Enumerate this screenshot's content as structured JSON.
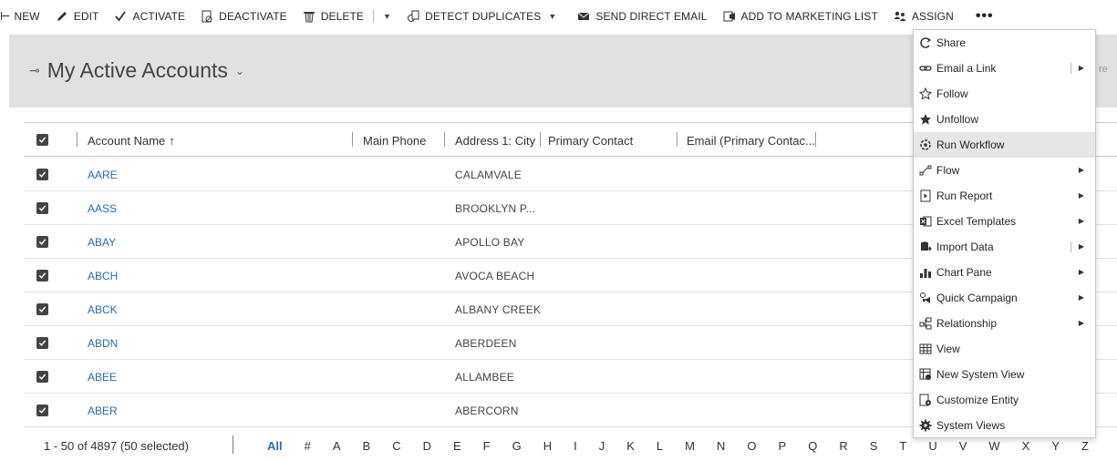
{
  "toolbar": {
    "new": "NEW",
    "edit": "EDIT",
    "activate": "ACTIVATE",
    "deactivate": "DEACTIVATE",
    "delete": "DELETE",
    "detect_duplicates": "DETECT DUPLICATES",
    "send_direct_email": "SEND DIRECT EMAIL",
    "add_to_marketing_list": "ADD TO MARKETING LIST",
    "assign": "ASSIGN",
    "more": "•••"
  },
  "view": {
    "title": "My Active Accounts"
  },
  "columns": {
    "account_name": "Account Name",
    "sort_icon": "↑",
    "main_phone": "Main Phone",
    "city": "Address 1: City",
    "primary_contact": "Primary Contact",
    "email": "Email (Primary Contac..."
  },
  "rows": [
    {
      "name": "AARE",
      "city": "CALAMVALE"
    },
    {
      "name": "AASS",
      "city": "BROOKLYN P..."
    },
    {
      "name": "ABAY",
      "city": "APOLLO BAY"
    },
    {
      "name": "ABCH",
      "city": "AVOCA BEACH"
    },
    {
      "name": "ABCK",
      "city": "ALBANY CREEK"
    },
    {
      "name": "ABDN",
      "city": "ABERDEEN"
    },
    {
      "name": "ABEE",
      "city": "ALLAMBEE"
    },
    {
      "name": "ABER",
      "city": "ABERCORN"
    }
  ],
  "footer": {
    "record_count": "1 - 50 of 4897 (50 selected)",
    "letters": [
      "All",
      "#",
      "A",
      "B",
      "C",
      "D",
      "E",
      "F",
      "G",
      "H",
      "I",
      "J",
      "K",
      "L",
      "M",
      "N",
      "O",
      "P",
      "Q",
      "R",
      "S",
      "T",
      "U",
      "V",
      "W",
      "X",
      "Y",
      "Z"
    ]
  },
  "menu": {
    "items": [
      {
        "label": "Share",
        "icon": "share-icon",
        "submenu": false
      },
      {
        "label": "Email a Link",
        "icon": "link-icon",
        "submenu": true
      },
      {
        "label": "Follow",
        "icon": "star-outline-icon",
        "submenu": false
      },
      {
        "label": "Unfollow",
        "icon": "star-filled-icon",
        "submenu": false
      },
      {
        "label": "Run Workflow",
        "icon": "workflow-icon",
        "submenu": false,
        "highlighted": true
      },
      {
        "label": "Flow",
        "icon": "flow-icon",
        "submenu": true
      },
      {
        "label": "Run Report",
        "icon": "report-icon",
        "submenu": true
      },
      {
        "label": "Excel Templates",
        "icon": "excel-icon",
        "submenu": true
      },
      {
        "label": "Import Data",
        "icon": "import-icon",
        "submenu": true
      },
      {
        "label": "Chart Pane",
        "icon": "chart-icon",
        "submenu": true
      },
      {
        "label": "Quick Campaign",
        "icon": "campaign-icon",
        "submenu": true
      },
      {
        "label": "Relationship",
        "icon": "relationship-icon",
        "submenu": true
      },
      {
        "label": "View",
        "icon": "view-icon",
        "submenu": false
      },
      {
        "label": "New System View",
        "icon": "new-view-icon",
        "submenu": false
      },
      {
        "label": "Customize Entity",
        "icon": "customize-icon",
        "submenu": false
      },
      {
        "label": "System Views",
        "icon": "gear-icon",
        "submenu": false
      }
    ]
  },
  "search_edge_text": "re"
}
